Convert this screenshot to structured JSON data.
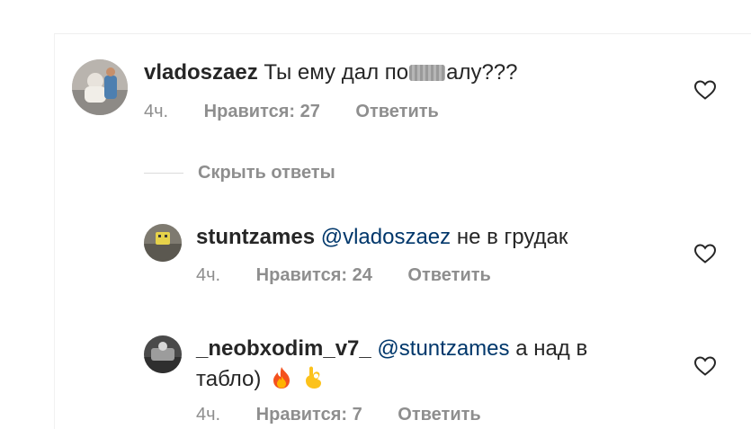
{
  "comments": [
    {
      "username": "vladoszaez",
      "text_before": "Ты ему дал по",
      "text_after": "алу???",
      "time": "4ч.",
      "likes": "Нравится: 27",
      "reply": "Ответить"
    }
  ],
  "hide_replies": "Скрыть ответы",
  "replies": [
    {
      "username": "stuntzames",
      "mention": "@vladoszaez",
      "text": "не в грудак",
      "time": "4ч.",
      "likes": "Нравится: 24",
      "reply": "Ответить"
    },
    {
      "username": "_neobxodim_v7_",
      "mention": "@stuntzames",
      "text": "а над в",
      "text_line2": "табло)",
      "time": "4ч.",
      "likes": "Нравится: 7",
      "reply": "Ответить"
    }
  ],
  "icons": [
    "heart-icon",
    "fire-emoji",
    "ok-hand-emoji"
  ],
  "colors": {
    "text": "#262626",
    "meta": "#8e8e8e",
    "mention": "#00376b"
  }
}
